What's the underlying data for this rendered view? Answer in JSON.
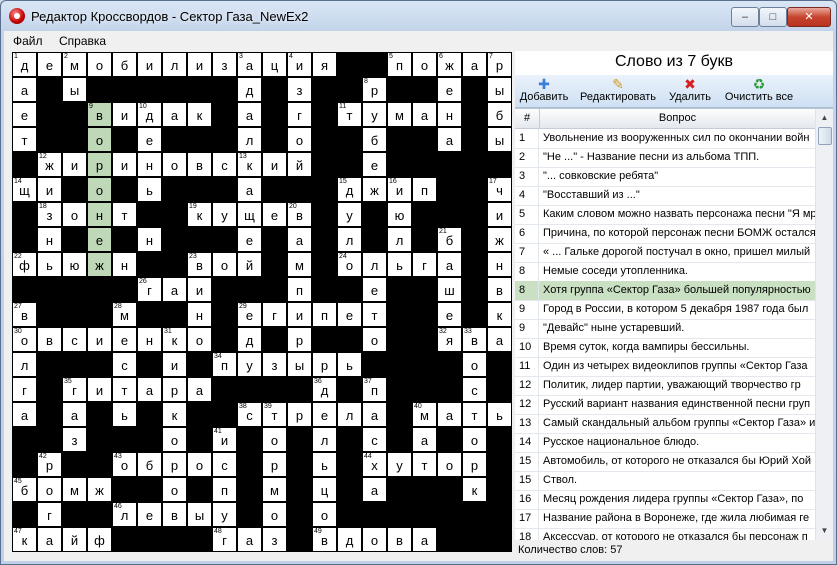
{
  "window": {
    "title": "Редактор Кроссвордов - Сектор Газа_NewEx2",
    "min_label": "–",
    "max_label": "□",
    "close_label": "✕"
  },
  "menu": [
    "Файл",
    "Справка"
  ],
  "panel": {
    "heading": "Слово из 7 букв"
  },
  "toolbar": [
    {
      "label": "Добавить",
      "icon": "plus-icon",
      "glyph": "✚",
      "color": "#3a7fd6"
    },
    {
      "label": "Редактировать",
      "icon": "pencil-icon",
      "glyph": "✎",
      "color": "#d49a20"
    },
    {
      "label": "Удалить",
      "icon": "delete-x-icon",
      "glyph": "✖",
      "color": "#d42020"
    },
    {
      "label": "Очистить все",
      "icon": "clear-all-icon",
      "glyph": "♻",
      "color": "#2e9a3a"
    }
  ],
  "table": {
    "columns": [
      "#",
      "Вопрос"
    ],
    "selected_index": 8,
    "rows": [
      {
        "num": "1",
        "question": "Увольнение из вооруженных сил по окончании войн"
      },
      {
        "num": "2",
        "question": "\"Не ...\" - Название песни из альбома ТПП."
      },
      {
        "num": "3",
        "question": "\"... совковские ребята\""
      },
      {
        "num": "4",
        "question": "\"Восставший из ...\""
      },
      {
        "num": "5",
        "question": "Каким словом можно назвать персонажа песни \"Я мр"
      },
      {
        "num": "6",
        "question": "Причина, по которой персонаж песни БОМЖ остался"
      },
      {
        "num": "7",
        "question": "« ... Гальке дорогой постучал в окно, пришел милый"
      },
      {
        "num": "8",
        "question": "Немые соседи утопленника."
      },
      {
        "num": "8",
        "question": "Хотя группа «Сектор Газа» большей популярностью"
      },
      {
        "num": "9",
        "question": "Город в России, в котором 5 декабря 1987 года был"
      },
      {
        "num": "9",
        "question": "\"Девайс\" ныне устаревший."
      },
      {
        "num": "10",
        "question": "Время суток, когда вампиры бессильны."
      },
      {
        "num": "11",
        "question": "Один из четырех видеоклипов группы «Сектор Газа"
      },
      {
        "num": "12",
        "question": "Политик, лидер партии, уважающий творчество гр"
      },
      {
        "num": "12",
        "question": "Русский вариант названия единственной песни груп"
      },
      {
        "num": "13",
        "question": "Самый скандальный альбом группы «Сектор Газа» и"
      },
      {
        "num": "14",
        "question": "Русское национальное блюдо."
      },
      {
        "num": "15",
        "question": "Автомобиль, от которого не отказался бы Юрий Хой"
      },
      {
        "num": "15",
        "question": "Ствол."
      },
      {
        "num": "16",
        "question": "Месяц рождения лидера группы «Сектор Газа», по"
      },
      {
        "num": "17",
        "question": "Название района в Воронеже, где жила любимая ге"
      },
      {
        "num": "18",
        "question": "Аксессуар, от которого не отказался бы персонаж п"
      }
    ]
  },
  "status": {
    "word_count": "Количество слов: 57"
  },
  "grid": {
    "size": 20,
    "highlight_color": "#bfd8b8",
    "cells": [
      [
        0,
        0,
        "д",
        "1"
      ],
      [
        0,
        1,
        "е",
        ""
      ],
      [
        0,
        2,
        "м",
        "2"
      ],
      [
        0,
        3,
        "о",
        ""
      ],
      [
        0,
        4,
        "б",
        ""
      ],
      [
        0,
        5,
        "и",
        ""
      ],
      [
        0,
        6,
        "л",
        ""
      ],
      [
        0,
        7,
        "и",
        ""
      ],
      [
        0,
        8,
        "з",
        ""
      ],
      [
        0,
        9,
        "а",
        "3"
      ],
      [
        0,
        10,
        "ц",
        ""
      ],
      [
        0,
        11,
        "и",
        "4"
      ],
      [
        0,
        12,
        "я",
        ""
      ],
      [
        0,
        15,
        "п",
        "5"
      ],
      [
        0,
        16,
        "о",
        ""
      ],
      [
        0,
        17,
        "ж",
        "6"
      ],
      [
        0,
        18,
        "а",
        ""
      ],
      [
        0,
        19,
        "р",
        "7"
      ],
      [
        1,
        0,
        "а",
        ""
      ],
      [
        1,
        2,
        "ы",
        ""
      ],
      [
        1,
        9,
        "д",
        ""
      ],
      [
        1,
        11,
        "з",
        ""
      ],
      [
        1,
        14,
        "р",
        "8"
      ],
      [
        1,
        17,
        "е",
        ""
      ],
      [
        1,
        19,
        "ы",
        ""
      ],
      [
        2,
        0,
        "е",
        ""
      ],
      [
        2,
        3,
        "в",
        "9",
        "hl"
      ],
      [
        2,
        4,
        "и",
        ""
      ],
      [
        2,
        5,
        "д",
        "10"
      ],
      [
        2,
        6,
        "а",
        ""
      ],
      [
        2,
        7,
        "к",
        ""
      ],
      [
        2,
        9,
        "а",
        ""
      ],
      [
        2,
        11,
        "г",
        ""
      ],
      [
        2,
        13,
        "т",
        "11"
      ],
      [
        2,
        14,
        "у",
        ""
      ],
      [
        2,
        15,
        "м",
        ""
      ],
      [
        2,
        16,
        "а",
        ""
      ],
      [
        2,
        17,
        "н",
        ""
      ],
      [
        2,
        19,
        "б",
        ""
      ],
      [
        3,
        0,
        "т",
        ""
      ],
      [
        3,
        3,
        "о",
        "",
        "hl"
      ],
      [
        3,
        5,
        "е",
        ""
      ],
      [
        3,
        9,
        "л",
        ""
      ],
      [
        3,
        11,
        "о",
        ""
      ],
      [
        3,
        14,
        "б",
        ""
      ],
      [
        3,
        17,
        "а",
        ""
      ],
      [
        3,
        19,
        "ы",
        ""
      ],
      [
        4,
        1,
        "ж",
        "12"
      ],
      [
        4,
        2,
        "и",
        ""
      ],
      [
        4,
        3,
        "р",
        "",
        "hl"
      ],
      [
        4,
        4,
        "и",
        ""
      ],
      [
        4,
        5,
        "н",
        ""
      ],
      [
        4,
        6,
        "о",
        ""
      ],
      [
        4,
        7,
        "в",
        ""
      ],
      [
        4,
        8,
        "с",
        ""
      ],
      [
        4,
        9,
        "к",
        "13"
      ],
      [
        4,
        10,
        "и",
        ""
      ],
      [
        4,
        11,
        "й",
        ""
      ],
      [
        4,
        14,
        "е",
        ""
      ],
      [
        5,
        0,
        "щ",
        "14"
      ],
      [
        5,
        1,
        "и",
        ""
      ],
      [
        5,
        3,
        "о",
        "",
        "hl"
      ],
      [
        5,
        5,
        "ь",
        ""
      ],
      [
        5,
        9,
        "а",
        ""
      ],
      [
        5,
        13,
        "д",
        "15"
      ],
      [
        5,
        14,
        "ж",
        ""
      ],
      [
        5,
        15,
        "и",
        "16"
      ],
      [
        5,
        16,
        "п",
        ""
      ],
      [
        5,
        19,
        "ч",
        "17"
      ],
      [
        6,
        1,
        "з",
        "18"
      ],
      [
        6,
        2,
        "о",
        ""
      ],
      [
        6,
        3,
        "н",
        "",
        "hl"
      ],
      [
        6,
        4,
        "т",
        ""
      ],
      [
        6,
        7,
        "к",
        "19"
      ],
      [
        6,
        8,
        "у",
        ""
      ],
      [
        6,
        9,
        "щ",
        ""
      ],
      [
        6,
        10,
        "е",
        ""
      ],
      [
        6,
        11,
        "в",
        "20"
      ],
      [
        6,
        13,
        "у",
        ""
      ],
      [
        6,
        15,
        "ю",
        ""
      ],
      [
        6,
        19,
        "и",
        ""
      ],
      [
        7,
        1,
        "н",
        ""
      ],
      [
        7,
        3,
        "е",
        "",
        "hl"
      ],
      [
        7,
        5,
        "н",
        ""
      ],
      [
        7,
        9,
        "е",
        ""
      ],
      [
        7,
        11,
        "а",
        ""
      ],
      [
        7,
        13,
        "л",
        ""
      ],
      [
        7,
        15,
        "л",
        ""
      ],
      [
        7,
        17,
        "б",
        "21"
      ],
      [
        7,
        19,
        "ж",
        ""
      ],
      [
        8,
        0,
        "ф",
        "22"
      ],
      [
        8,
        1,
        "ь",
        ""
      ],
      [
        8,
        2,
        "ю",
        ""
      ],
      [
        8,
        3,
        "ж",
        "",
        "hl"
      ],
      [
        8,
        4,
        "н",
        ""
      ],
      [
        8,
        7,
        "в",
        "23"
      ],
      [
        8,
        8,
        "о",
        ""
      ],
      [
        8,
        9,
        "й",
        ""
      ],
      [
        8,
        11,
        "м",
        ""
      ],
      [
        8,
        13,
        "о",
        "24"
      ],
      [
        8,
        14,
        "л",
        ""
      ],
      [
        8,
        15,
        "ь",
        ""
      ],
      [
        8,
        16,
        "г",
        ""
      ],
      [
        8,
        17,
        "а",
        ""
      ],
      [
        8,
        19,
        "н",
        ""
      ],
      [
        9,
        5,
        "г",
        "26"
      ],
      [
        9,
        6,
        "а",
        ""
      ],
      [
        9,
        7,
        "и",
        ""
      ],
      [
        9,
        11,
        "п",
        ""
      ],
      [
        9,
        14,
        "е",
        ""
      ],
      [
        9,
        17,
        "ш",
        ""
      ],
      [
        9,
        19,
        "в",
        ""
      ],
      [
        10,
        0,
        "в",
        "27"
      ],
      [
        10,
        4,
        "м",
        "28"
      ],
      [
        10,
        7,
        "н",
        ""
      ],
      [
        10,
        9,
        "е",
        "29"
      ],
      [
        10,
        10,
        "г",
        ""
      ],
      [
        10,
        11,
        "и",
        ""
      ],
      [
        10,
        12,
        "п",
        ""
      ],
      [
        10,
        13,
        "е",
        ""
      ],
      [
        10,
        14,
        "т",
        ""
      ],
      [
        10,
        17,
        "е",
        ""
      ],
      [
        10,
        19,
        "к",
        ""
      ],
      [
        11,
        0,
        "о",
        "30"
      ],
      [
        11,
        1,
        "в",
        ""
      ],
      [
        11,
        2,
        "с",
        ""
      ],
      [
        11,
        3,
        "и",
        ""
      ],
      [
        11,
        4,
        "е",
        ""
      ],
      [
        11,
        5,
        "н",
        ""
      ],
      [
        11,
        6,
        "к",
        "31"
      ],
      [
        11,
        7,
        "о",
        ""
      ],
      [
        11,
        9,
        "д",
        ""
      ],
      [
        11,
        11,
        "р",
        ""
      ],
      [
        11,
        14,
        "о",
        ""
      ],
      [
        11,
        17,
        "я",
        "32"
      ],
      [
        11,
        18,
        "в",
        "33"
      ],
      [
        11,
        19,
        "а",
        ""
      ],
      [
        12,
        0,
        "л",
        ""
      ],
      [
        12,
        4,
        "с",
        ""
      ],
      [
        12,
        6,
        "и",
        ""
      ],
      [
        12,
        8,
        "п",
        "34"
      ],
      [
        12,
        9,
        "у",
        ""
      ],
      [
        12,
        10,
        "з",
        ""
      ],
      [
        12,
        11,
        "ы",
        ""
      ],
      [
        12,
        12,
        "р",
        ""
      ],
      [
        12,
        13,
        "ь",
        ""
      ],
      [
        12,
        18,
        "о",
        ""
      ],
      [
        13,
        0,
        "г",
        ""
      ],
      [
        13,
        2,
        "г",
        "35"
      ],
      [
        13,
        3,
        "и",
        ""
      ],
      [
        13,
        4,
        "т",
        ""
      ],
      [
        13,
        5,
        "а",
        ""
      ],
      [
        13,
        6,
        "р",
        ""
      ],
      [
        13,
        7,
        "а",
        ""
      ],
      [
        13,
        12,
        "д",
        "36"
      ],
      [
        13,
        14,
        "п",
        "37"
      ],
      [
        13,
        18,
        "с",
        ""
      ],
      [
        14,
        0,
        "а",
        ""
      ],
      [
        14,
        2,
        "а",
        ""
      ],
      [
        14,
        4,
        "ь",
        ""
      ],
      [
        14,
        6,
        "к",
        ""
      ],
      [
        14,
        9,
        "с",
        "38"
      ],
      [
        14,
        10,
        "т",
        "39"
      ],
      [
        14,
        11,
        "р",
        ""
      ],
      [
        14,
        12,
        "е",
        ""
      ],
      [
        14,
        13,
        "л",
        ""
      ],
      [
        14,
        14,
        "а",
        ""
      ],
      [
        14,
        16,
        "м",
        "40"
      ],
      [
        14,
        17,
        "а",
        ""
      ],
      [
        14,
        18,
        "т",
        ""
      ],
      [
        14,
        19,
        "ь",
        ""
      ],
      [
        15,
        2,
        "з",
        ""
      ],
      [
        15,
        6,
        "о",
        ""
      ],
      [
        15,
        8,
        "и",
        "41"
      ],
      [
        15,
        10,
        "о",
        ""
      ],
      [
        15,
        12,
        "л",
        ""
      ],
      [
        15,
        14,
        "с",
        ""
      ],
      [
        15,
        16,
        "а",
        ""
      ],
      [
        15,
        18,
        "о",
        ""
      ],
      [
        16,
        1,
        "р",
        "42"
      ],
      [
        16,
        4,
        "о",
        "43"
      ],
      [
        16,
        5,
        "б",
        ""
      ],
      [
        16,
        6,
        "р",
        ""
      ],
      [
        16,
        7,
        "о",
        ""
      ],
      [
        16,
        8,
        "с",
        ""
      ],
      [
        16,
        10,
        "р",
        ""
      ],
      [
        16,
        12,
        "ь",
        ""
      ],
      [
        16,
        14,
        "х",
        "44"
      ],
      [
        16,
        15,
        "у",
        ""
      ],
      [
        16,
        16,
        "т",
        ""
      ],
      [
        16,
        17,
        "о",
        ""
      ],
      [
        16,
        18,
        "р",
        ""
      ],
      [
        17,
        0,
        "б",
        "45"
      ],
      [
        17,
        1,
        "о",
        ""
      ],
      [
        17,
        2,
        "м",
        ""
      ],
      [
        17,
        3,
        "ж",
        ""
      ],
      [
        17,
        6,
        "о",
        ""
      ],
      [
        17,
        8,
        "п",
        ""
      ],
      [
        17,
        10,
        "м",
        ""
      ],
      [
        17,
        12,
        "ц",
        ""
      ],
      [
        17,
        14,
        "а",
        ""
      ],
      [
        17,
        18,
        "к",
        ""
      ],
      [
        18,
        1,
        "г",
        ""
      ],
      [
        18,
        4,
        "л",
        "46"
      ],
      [
        18,
        5,
        "е",
        ""
      ],
      [
        18,
        6,
        "в",
        ""
      ],
      [
        18,
        7,
        "ы",
        ""
      ],
      [
        18,
        8,
        "у",
        ""
      ],
      [
        18,
        10,
        "о",
        ""
      ],
      [
        18,
        12,
        "о",
        ""
      ],
      [
        19,
        0,
        "к",
        "47"
      ],
      [
        19,
        1,
        "а",
        ""
      ],
      [
        19,
        2,
        "й",
        ""
      ],
      [
        19,
        3,
        "ф",
        ""
      ],
      [
        19,
        8,
        "г",
        "48"
      ],
      [
        19,
        9,
        "а",
        ""
      ],
      [
        19,
        10,
        "з",
        ""
      ],
      [
        19,
        12,
        "в",
        "49"
      ],
      [
        19,
        13,
        "д",
        ""
      ],
      [
        19,
        14,
        "о",
        ""
      ],
      [
        19,
        15,
        "в",
        ""
      ],
      [
        19,
        16,
        "а",
        ""
      ]
    ]
  }
}
